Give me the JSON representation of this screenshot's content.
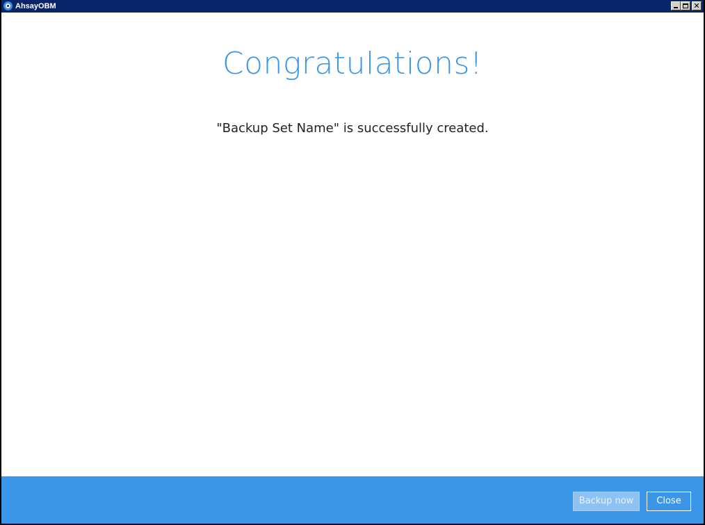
{
  "window": {
    "title": "AhsayOBM",
    "controls": {
      "minimize": "minimize",
      "maximize": "maximize",
      "close": "✕"
    }
  },
  "main": {
    "heading": "Congratulations!",
    "message": "\"Backup Set Name\" is successfully created."
  },
  "footer": {
    "backup_now_label": "Backup now",
    "close_label": "Close"
  },
  "colors": {
    "accent": "#3c96e8",
    "titlebar": "#0a246a"
  },
  "icons": {
    "app": "ahsay-logo-icon"
  }
}
